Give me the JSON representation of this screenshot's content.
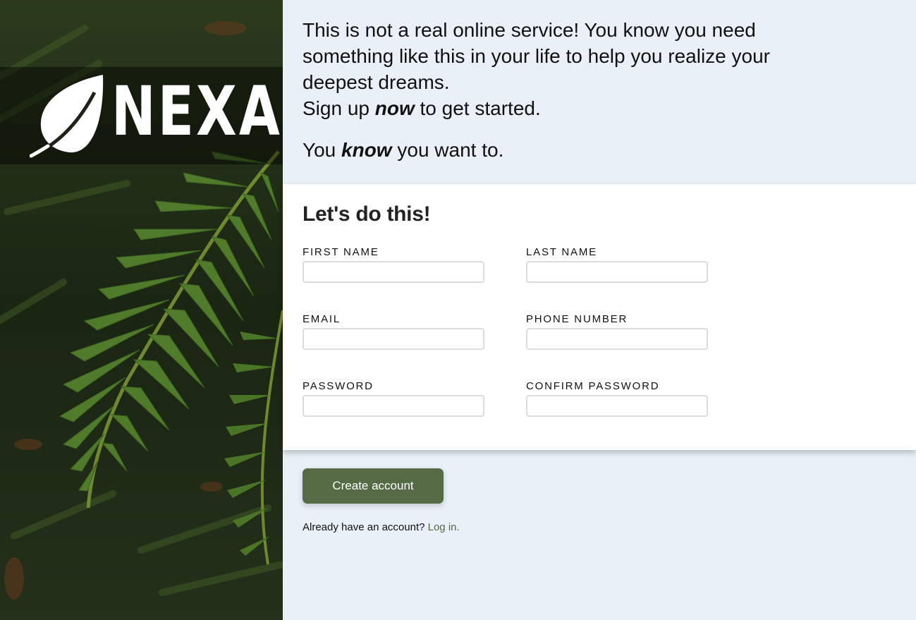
{
  "brand": {
    "name": "NEXA"
  },
  "intro": {
    "line1_part1": "This is not a real online service! You know you need something like this in your life to help you realize your deepest dreams.",
    "line1_part2_before": "Sign up ",
    "line1_part2_emphasis": "now",
    "line1_part2_after": " to get started.",
    "line2_before": "You ",
    "line2_emphasis": "know",
    "line2_after": " you want to."
  },
  "form": {
    "heading": "Let's do this!",
    "fields": {
      "first_name": {
        "label": "FIRST NAME",
        "value": ""
      },
      "last_name": {
        "label": "LAST NAME",
        "value": ""
      },
      "email": {
        "label": "EMAIL",
        "value": ""
      },
      "phone": {
        "label": "PHONE NUMBER",
        "value": ""
      },
      "password": {
        "label": "PASSWORD",
        "value": ""
      },
      "confirm_password": {
        "label": "CONFIRM PASSWORD",
        "value": ""
      }
    }
  },
  "actions": {
    "create_label": "Create account",
    "login_prompt": "Already have an account? ",
    "login_link": "Log in."
  },
  "colors": {
    "page_background": "#e9f0f7",
    "accent": "#556b45",
    "card": "#ffffff"
  },
  "icons": {
    "logo": "leaf-icon"
  }
}
